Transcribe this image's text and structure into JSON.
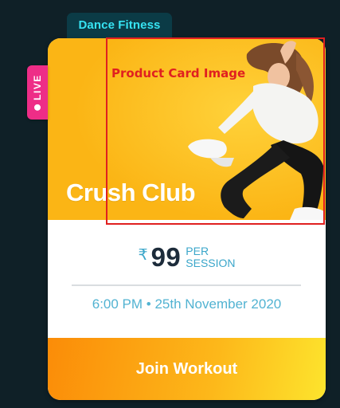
{
  "category": {
    "label": "Dance Fitness",
    "color": "#36e3f2"
  },
  "live_badge": {
    "label": "LIVE",
    "color": "#ee2d87"
  },
  "product": {
    "title": "Crush Club",
    "image_annotation": "Product Card Image"
  },
  "pricing": {
    "currency_symbol": "₹",
    "amount": "99",
    "unit_line1": "PER",
    "unit_line2": "SESSION"
  },
  "session": {
    "time": "6:00 PM • 25th November 2020"
  },
  "cta": {
    "label": "Join Workout"
  },
  "colors": {
    "background": "#0f2027",
    "hero": "#fdbb17",
    "accent_blue": "#3aa6ca",
    "annotation_red": "#e02020"
  }
}
